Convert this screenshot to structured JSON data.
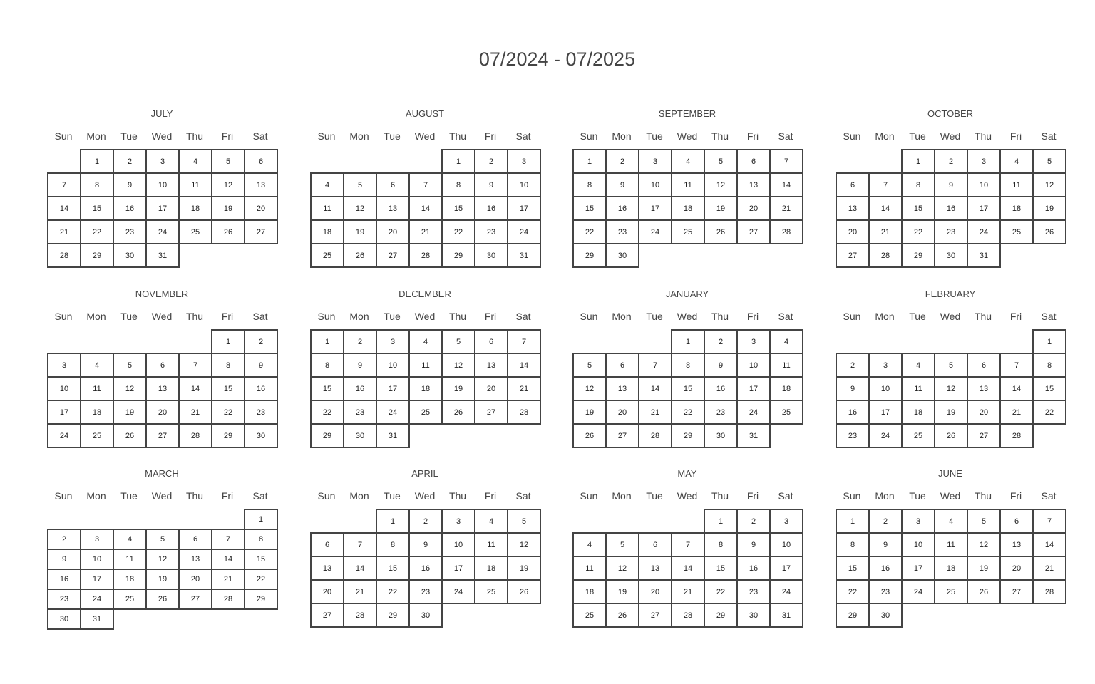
{
  "title": "07/2024 - 07/2025",
  "weekdays": [
    "Sun",
    "Mon",
    "Tue",
    "Wed",
    "Thu",
    "Fri",
    "Sat"
  ],
  "months": [
    {
      "name": "JULY",
      "start": 1,
      "days": 31
    },
    {
      "name": "AUGUST",
      "start": 4,
      "days": 31
    },
    {
      "name": "SEPTEMBER",
      "start": 0,
      "days": 30
    },
    {
      "name": "OCTOBER",
      "start": 2,
      "days": 31
    },
    {
      "name": "NOVEMBER",
      "start": 5,
      "days": 30
    },
    {
      "name": "DECEMBER",
      "start": 0,
      "days": 31
    },
    {
      "name": "JANUARY",
      "start": 3,
      "days": 31
    },
    {
      "name": "FEBRUARY",
      "start": 6,
      "days": 28
    },
    {
      "name": "MARCH",
      "start": 6,
      "days": 31
    },
    {
      "name": "APRIL",
      "start": 2,
      "days": 30
    },
    {
      "name": "MAY",
      "start": 4,
      "days": 31
    },
    {
      "name": "JUNE",
      "start": 0,
      "days": 30
    }
  ]
}
